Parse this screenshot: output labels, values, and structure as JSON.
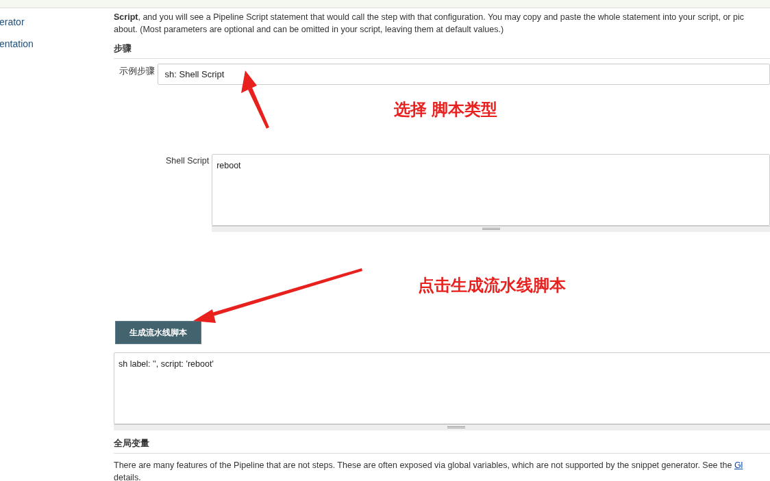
{
  "sidebar": {
    "items": [
      {
        "label": "erator"
      },
      {
        "label": "entation"
      }
    ]
  },
  "intro": {
    "lines": [
      "**Script**, and you will see a Pipeline Script statement that would call the step with that configuration. You may copy and paste the whole statement into your script, or pic",
      "about. (Most parameters are optional and can be omitted in your script, leaving them at default values.)"
    ]
  },
  "steps": {
    "heading": "步骤",
    "sample_step": {
      "label": "示例步骤",
      "value": "sh: Shell Script"
    },
    "shell_script": {
      "label": "Shell Script",
      "value": "reboot"
    }
  },
  "generate_button": {
    "label": "生成流水线脚本"
  },
  "output": {
    "value": "sh label: '', script: 'reboot'"
  },
  "globals": {
    "heading": "全局变量",
    "lines": [
      "There are many features of the Pipeline that are not steps. These are often exposed via global variables, which are not supported by the snippet generator. See the ",
      "details."
    ],
    "link": "Gl"
  },
  "annotations": [
    {
      "text": "选择 脚本类型"
    },
    {
      "text": "点击生成流水线脚本"
    }
  ]
}
